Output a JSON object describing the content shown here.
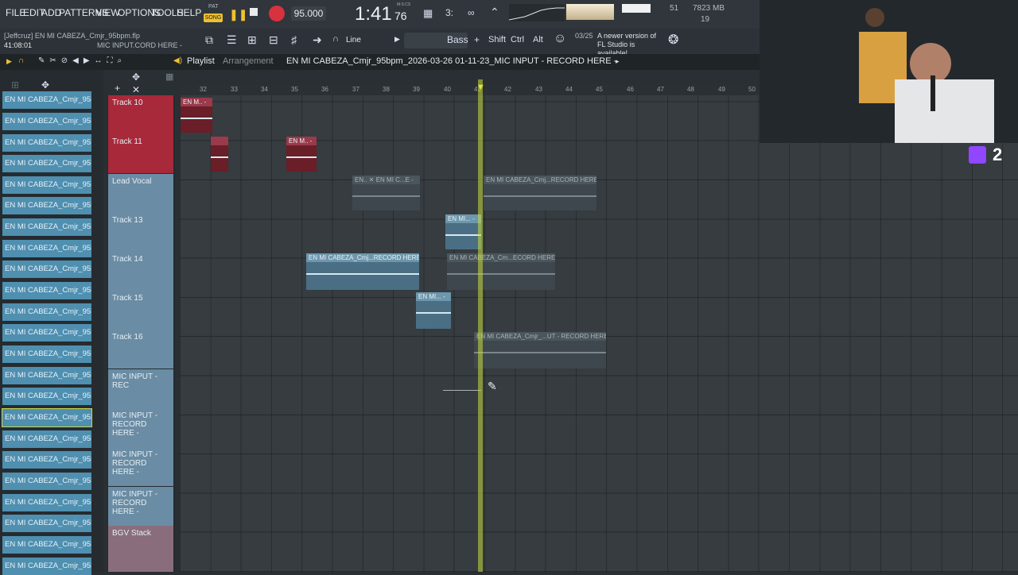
{
  "menu": [
    "FILE",
    "EDIT",
    "ADD",
    "PATTERNS",
    "VIEW",
    "OPTIONS",
    "TOOLS",
    "HELP"
  ],
  "transport": {
    "pat_label": "PAT",
    "song_label": "SONG",
    "tempo": "95.000",
    "time": "1:41",
    "time_sub": "76",
    "time_unit": "M:S:CS"
  },
  "info": {
    "project": "[Jeffcruz] EN MI CABEZA_Cmjr_95bpm.flp",
    "elapsed": "41:08:01",
    "hint": "MIC INPUT.CORD HERE -"
  },
  "tools": {
    "snap": "Line",
    "bass": "Bass",
    "shift": "Shift",
    "ctrl": "Ctrl",
    "alt": "Alt"
  },
  "cpu": {
    "memory": "7823 MB",
    "voices": "19",
    "poly": "51"
  },
  "news": {
    "date": "03/25",
    "text": "A newer version of FL Studio is available!"
  },
  "playlist": {
    "title": "Playlist",
    "sub": "Arrangement",
    "file": "EN MI CABEZA_Cmjr_95bpm_2026-03-26 01-11-23_MIC INPUT - RECORD HERE -"
  },
  "ruler": [
    "32",
    "33",
    "34",
    "35",
    "36",
    "37",
    "38",
    "39",
    "40",
    "41",
    "42",
    "43",
    "44",
    "45",
    "46",
    "47",
    "48",
    "49",
    "50"
  ],
  "browser": [
    "EN MI CABEZA_Cmjr_95bp",
    "EN MI CABEZA_Cmjr_95bp",
    "EN MI CABEZA_Cmjr_95bp",
    "EN MI CABEZA_Cmjr_95bp",
    "EN MI CABEZA_Cmjr_95bp",
    "EN MI CABEZA_Cmjr_95bp",
    "EN MI CABEZA_Cmjr_95bp",
    "EN MI CABEZA_Cmjr_95bp",
    "EN MI CABEZA_Cmjr_95bp",
    "EN MI CABEZA_Cmjr_95bp",
    "EN MI CABEZA_Cmjr_95bp",
    "EN MI CABEZA_Cmjr_95bp",
    "EN MI CABEZA_Cmjr_95bp",
    "EN MI CABEZA_Cmjr_95bp",
    "EN MI CABEZA_Cmjr_95bp",
    "EN MI CABEZA_Cmjr_95bp",
    "EN MI CABEZA_Cmjr_95bp",
    "EN MI CABEZA_Cmjr_95bp",
    "EN MI CABEZA_Cmjr_95bp",
    "EN MI CABEZA_Cmjr_95bp",
    "EN MI CABEZA_Cmjr_95bp",
    "EN MI CABEZA_Cmjr_95bp",
    "EN MI CABEZA_Cmjr_95bp"
  ],
  "tracks": {
    "t10": "Track 10",
    "t11": "Track 11",
    "lead": "Lead Vocal",
    "t13": "Track 13",
    "t14": "Track 14",
    "t15": "Track 15",
    "t16": "Track 16",
    "mic": "MIC INPUT - REC",
    "mic1": "MIC INPUT - RECORD HERE -",
    "mic2": "MIC INPUT - RECORD HERE -",
    "mic3": "MIC INPUT - RECORD HERE -",
    "bgv": "BGV Stack"
  },
  "clips": {
    "c1": "EN M.. -",
    "c2": "",
    "c3": "EN M.. -",
    "c4": "EN.. ✕ EN MI C...E -",
    "c5": "EN MI CABEZA_Cmj...RECORD HERE -",
    "c6": "EN MI... -",
    "c7": "EN MI CABEZA_Cmj...RECORD HERE -",
    "c8": "EN MI CABEZA_Cm...ECORD HERE -",
    "c9": "EN MI... -",
    "c10": "EN MI CABEZA_Cmjr_...UT - RECORD HERE -"
  },
  "stream": {
    "twitch_count": "2"
  }
}
